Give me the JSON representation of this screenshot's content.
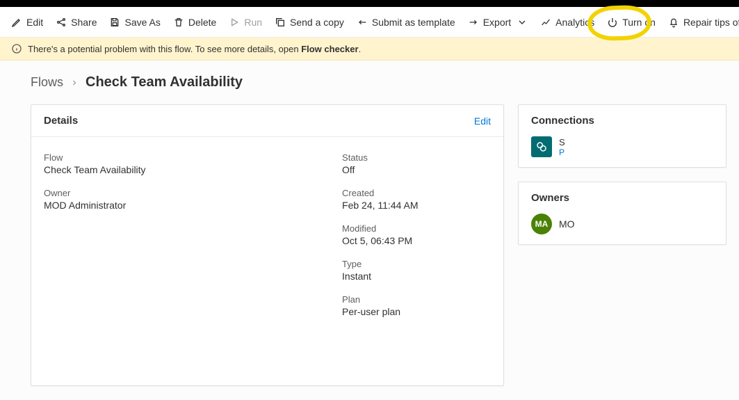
{
  "toolbar": {
    "edit": "Edit",
    "share": "Share",
    "save_as": "Save As",
    "delete": "Delete",
    "run": "Run",
    "send_copy": "Send a copy",
    "submit_template": "Submit as template",
    "export": "Export",
    "analytics": "Analytics",
    "turn_on": "Turn on",
    "repair_tips": "Repair tips off"
  },
  "banner": {
    "prefix": "There's a potential problem with this flow. To see more details, open ",
    "link": "Flow checker",
    "suffix": "."
  },
  "breadcrumb": {
    "root": "Flows",
    "current": "Check Team Availability"
  },
  "details": {
    "header": "Details",
    "edit": "Edit",
    "flow_label": "Flow",
    "flow_value": "Check Team Availability",
    "owner_label": "Owner",
    "owner_value": "MOD Administrator",
    "status_label": "Status",
    "status_value": "Off",
    "created_label": "Created",
    "created_value": "Feb 24, 11:44 AM",
    "modified_label": "Modified",
    "modified_value": "Oct 5, 06:43 PM",
    "type_label": "Type",
    "type_value": "Instant",
    "plan_label": "Plan",
    "plan_value": "Per-user plan"
  },
  "connections": {
    "header": "Connections",
    "item_line1": "S",
    "item_line2": "P"
  },
  "owners": {
    "header": "Owners",
    "avatar_initials": "MA",
    "name": "MO"
  }
}
